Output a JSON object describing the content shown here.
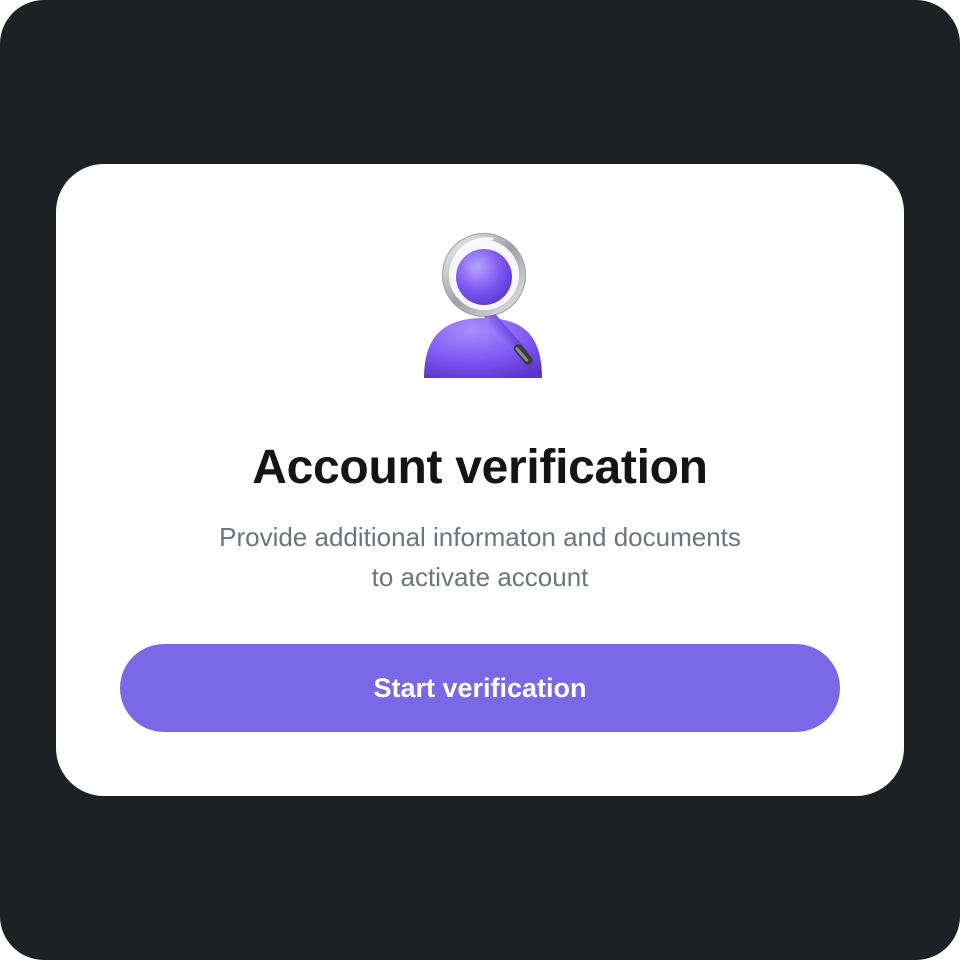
{
  "card": {
    "title": "Account verification",
    "description_lines": [
      "Provide additional informaton and documents",
      "to activate account"
    ],
    "button_label": "Start verification"
  },
  "illustration": {
    "icon": "user-search-icon"
  },
  "colors": {
    "background": "#1f2023",
    "card": "#ffffff",
    "accent": "#7b68e6",
    "title": "#141414",
    "subtitle": "#6f737c"
  }
}
